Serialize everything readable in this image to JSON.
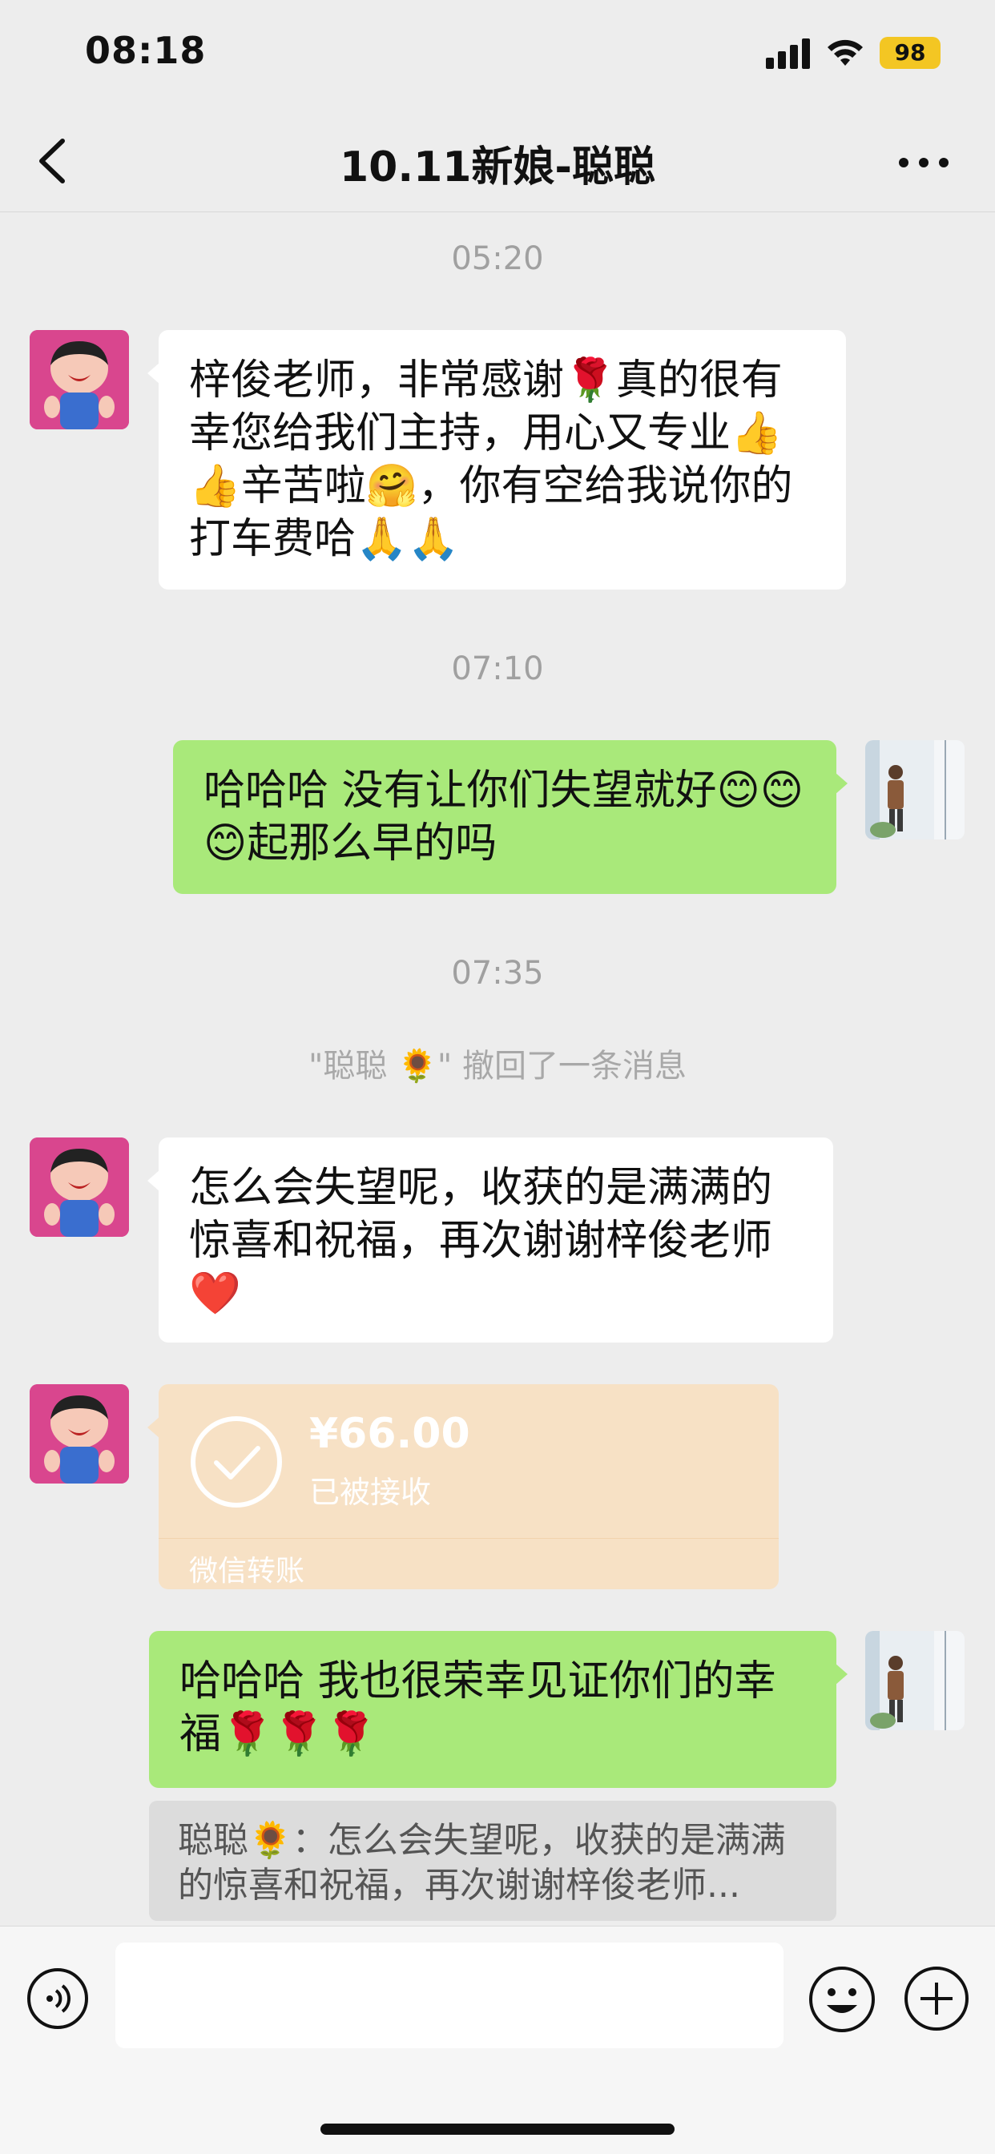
{
  "status_bar": {
    "time": "08:18",
    "battery": "98"
  },
  "nav": {
    "title": "10.11新娘-聪聪"
  },
  "messages": {
    "time1": "05:20",
    "msg1_text": "梓俊老师，非常感谢🌹真的很有幸您给我们主持，用心又专业👍👍辛苦啦🤗，你有空给我说你的打车费哈🙏🙏",
    "time2": "07:10",
    "msg2_text": "哈哈哈  没有让你们失望就好😊😊😊起那么早的吗",
    "time3": "07:35",
    "recall_note": "\"聪聪 🌻\" 撤回了一条消息",
    "msg3_text": "怎么会失望呢，收获的是满满的惊喜和祝福，再次谢谢梓俊老师❤️",
    "transfer": {
      "amount": "¥66.00",
      "status": "已被接收",
      "label": "微信转账"
    },
    "msg4_text": "哈哈哈 我也很荣幸见证你们的幸福🌹🌹🌹",
    "quote_text": "聪聪🌻：怎么会失望呢，收获的是满满的惊喜和祝福，再次谢谢梓俊老师..."
  },
  "input_bar": {
    "placeholder": ""
  },
  "icons": {
    "back": "chevron-left-icon",
    "more": "more-dots-icon",
    "voice": "voice-icon",
    "emoji": "emoji-icon",
    "plus": "plus-icon"
  },
  "colors": {
    "sent_bubble": "#a9e97a",
    "received_bubble": "#ffffff",
    "transfer_card": "#f7e1c5",
    "background": "#ededed"
  }
}
